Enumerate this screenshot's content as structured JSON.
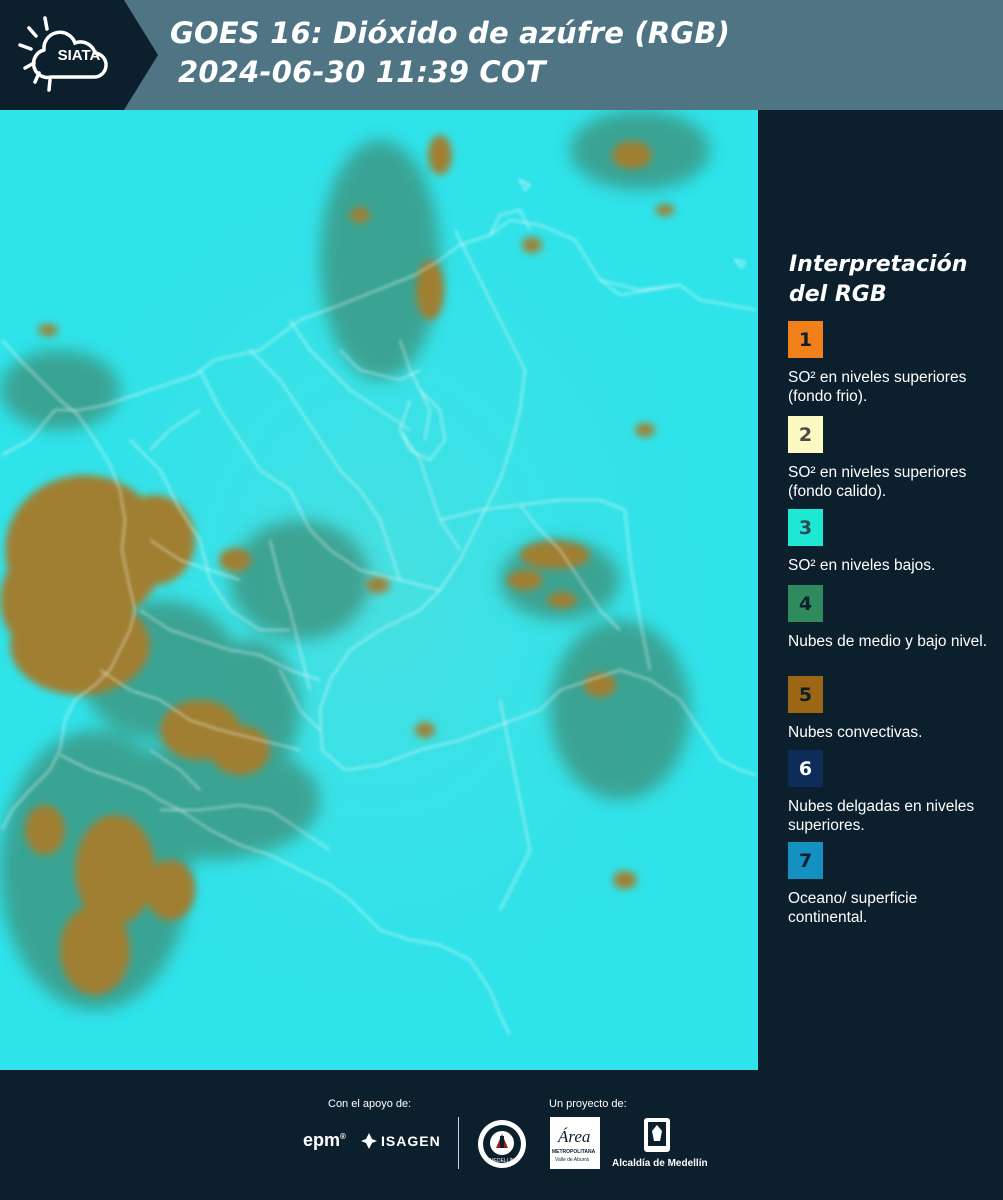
{
  "header": {
    "logo_text": "SIATA",
    "title_line1": "GOES 16: Dióxido de azúfre (RGB)",
    "title_line2": "2024-06-30 11:39 COT"
  },
  "map": {
    "background_color": "#2ee3ea",
    "cloud_colors": [
      "#3d8f78",
      "#8c7d35",
      "#a07f32"
    ],
    "border_color": "#ffffff"
  },
  "legend": {
    "title": "Interpretación del RGB",
    "items": [
      {
        "num": "1",
        "color": "#f08019",
        "text": "SO² en niveles superiores (fondo frio)."
      },
      {
        "num": "2",
        "color": "#fdf9c3",
        "text": "SO² en niveles superiores (fondo calido)."
      },
      {
        "num": "3",
        "color": "#1de8d3",
        "text": "SO² en niveles bajos."
      },
      {
        "num": "4",
        "color": "#2f8a5e",
        "text": "Nubes de medio y bajo nivel."
      },
      {
        "num": "5",
        "color": "#9c6614",
        "text": "Nubes convectivas."
      },
      {
        "num": "6",
        "color": "#0d2c59",
        "text": "Nubes delgadas en niveles superiores."
      },
      {
        "num": "7",
        "color": "#1591c1",
        "text": "Oceano/ superficie continental."
      }
    ]
  },
  "footer": {
    "support_label": "Con el apoyo de:",
    "project_label": "Un proyecto de:",
    "epm_text": "epm",
    "isagen_text": "ISAGEN",
    "area_text": "Área",
    "area_sub1": "METROPOLITANA",
    "area_sub2": "Valle de Aburrá",
    "alcaldia_text": "Alcaldía de Medellín",
    "seal_text": "MEDELLÍN"
  }
}
